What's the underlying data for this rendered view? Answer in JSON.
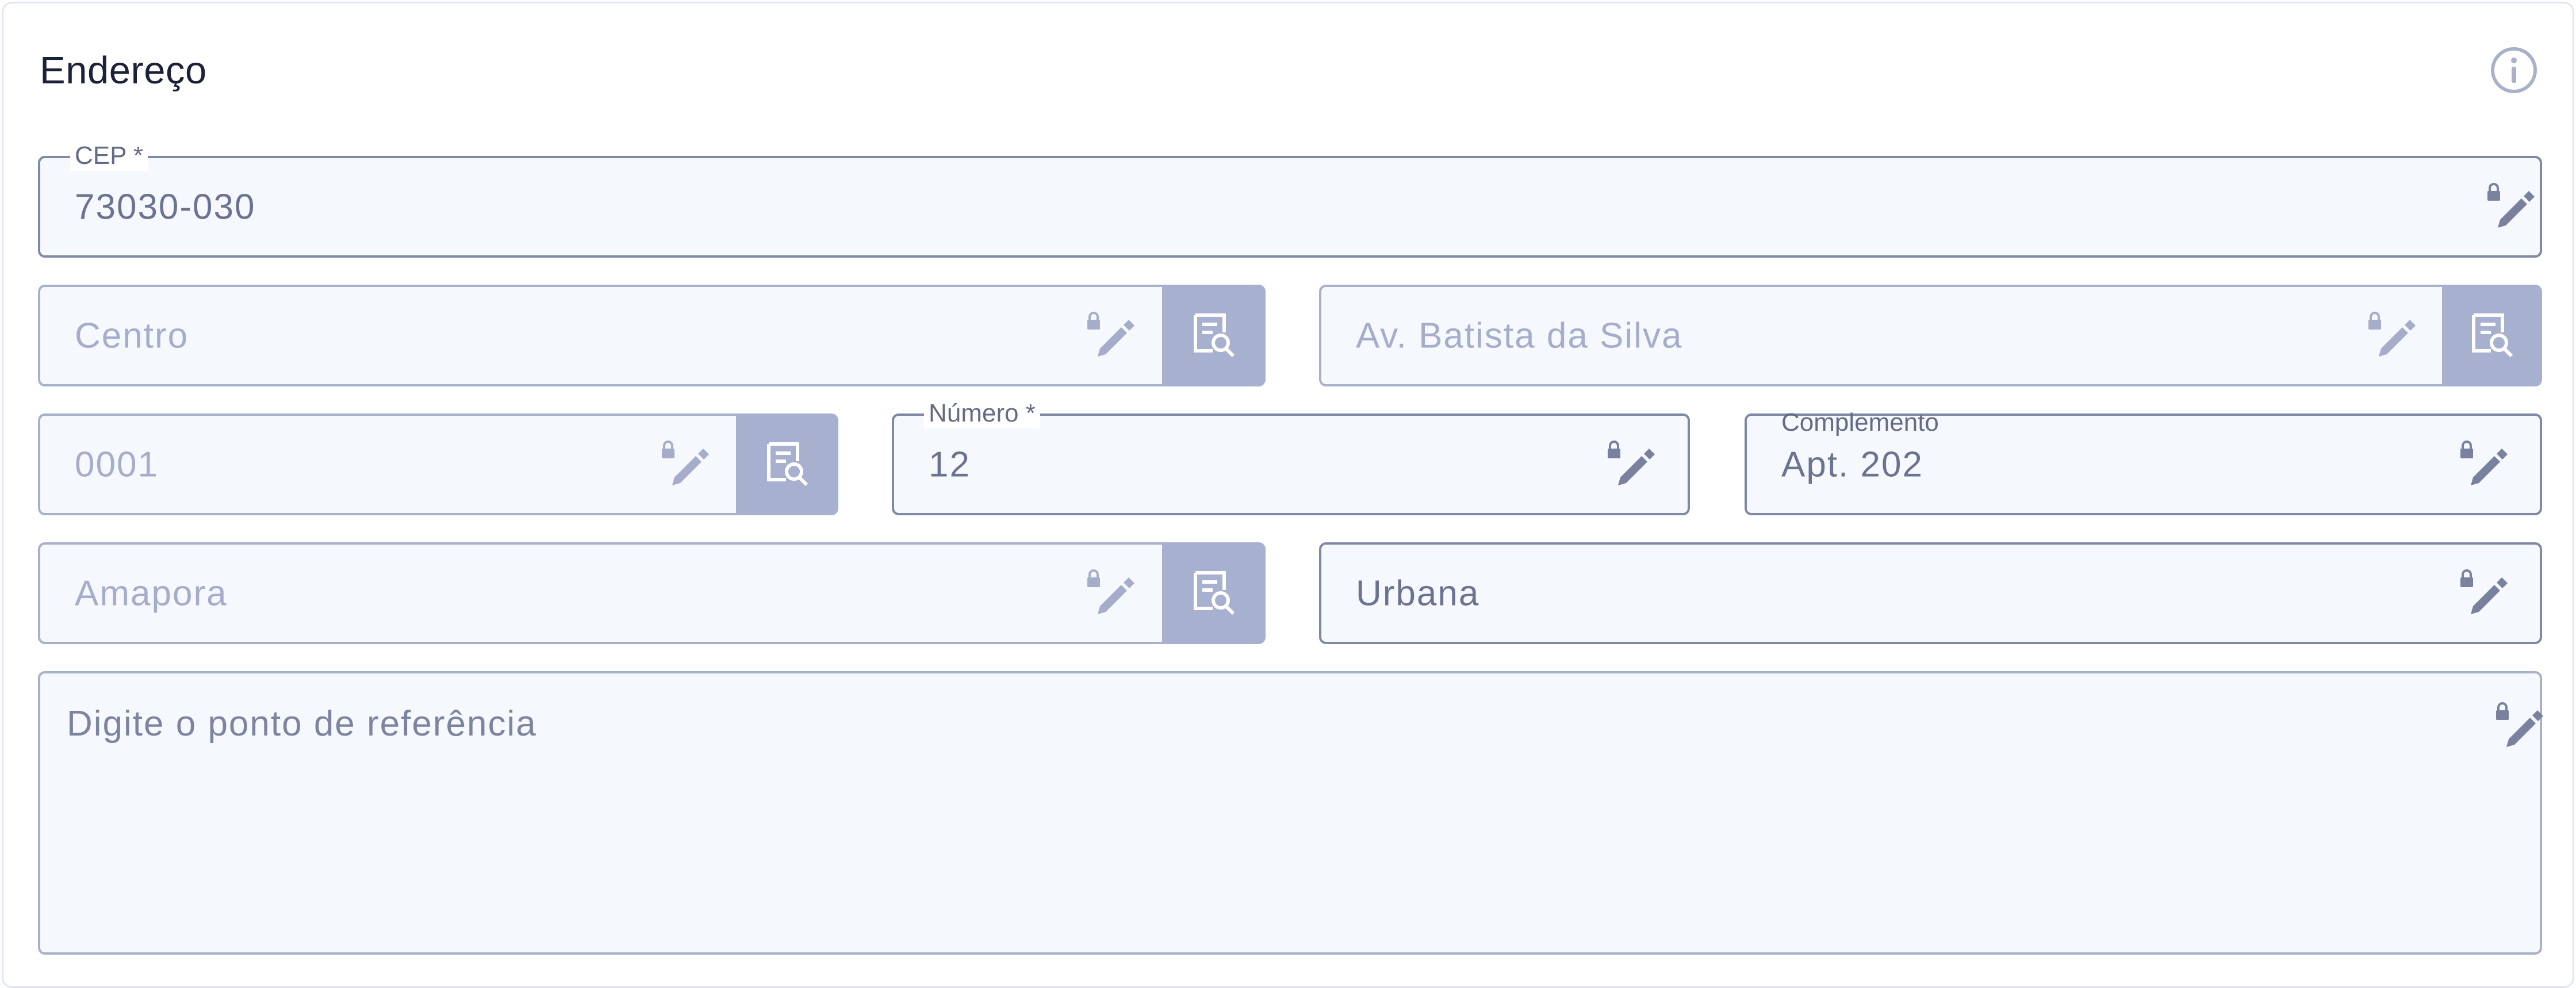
{
  "section": {
    "title": "Endereço",
    "info_icon": "info-icon"
  },
  "fields": {
    "cep": {
      "label": "CEP *",
      "value": "73030-030"
    },
    "bairro": {
      "value": "Centro"
    },
    "logradouro": {
      "value": "Av. Batista da Silva"
    },
    "codigo": {
      "value": "0001"
    },
    "numero": {
      "label": "Número *",
      "value": "12"
    },
    "complemento": {
      "label": "Complemento",
      "value": "Apt. 202"
    },
    "cidade": {
      "value": "Amapora"
    },
    "zona": {
      "value": "Urbana"
    },
    "referencia": {
      "placeholder": "Digite o ponto de referência"
    }
  },
  "icons": {
    "edit": "locked-edit-icon",
    "lookup": "document-search-icon"
  },
  "colors": {
    "field_bg": "#f5f8fd",
    "border": "#a9b1c8",
    "border_strong": "#7f88a5",
    "lookup_button": "#a7b0cf",
    "icon_muted": "#a5adca",
    "icon_strong": "#7a819e"
  }
}
